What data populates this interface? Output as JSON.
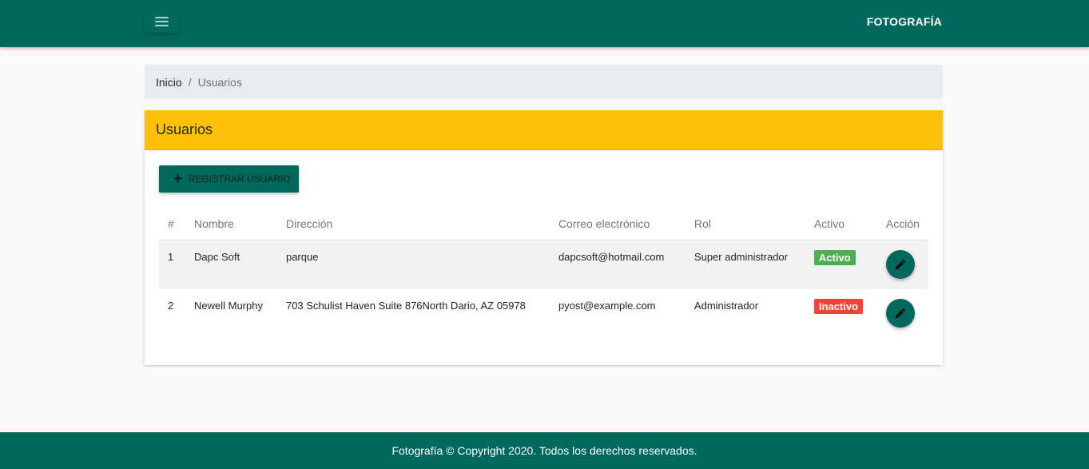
{
  "header": {
    "brand": "FOTOGRAFÍA",
    "menu_icon": "hamburger-icon"
  },
  "breadcrumb": {
    "home": "Inicio",
    "separator": "/",
    "current": "Usuarios"
  },
  "card": {
    "title": "Usuarios",
    "add_button_label": "REGISTRAR USUARIO",
    "add_button_icon": "plus-icon"
  },
  "table": {
    "columns": [
      "#",
      "Nombre",
      "Dirección",
      "Correo electrónico",
      "Rol",
      "Activo",
      "Acción"
    ],
    "rows": [
      {
        "num": "1",
        "name": "Dapc Soft",
        "address": "parque",
        "email": "dapcsoft@hotmail.com",
        "role": "Super administrador",
        "status": "Activo",
        "status_color": "#4caf50",
        "action_icon": "pencil-icon"
      },
      {
        "num": "2",
        "name": "Newell Murphy",
        "address": "703 Schulist Haven Suite 876North Dario, AZ 05978",
        "email": "pyost@example.com",
        "role": "Administrador",
        "status": "Inactivo",
        "status_color": "#f44336",
        "action_icon": "pencil-icon"
      }
    ]
  },
  "footer": {
    "text": "Fotografía © Copyright 2020. Todos los derechos reservados."
  },
  "colors": {
    "primary": "#00695c",
    "warning": "#ffc107",
    "success": "#4caf50",
    "danger": "#f44336"
  }
}
